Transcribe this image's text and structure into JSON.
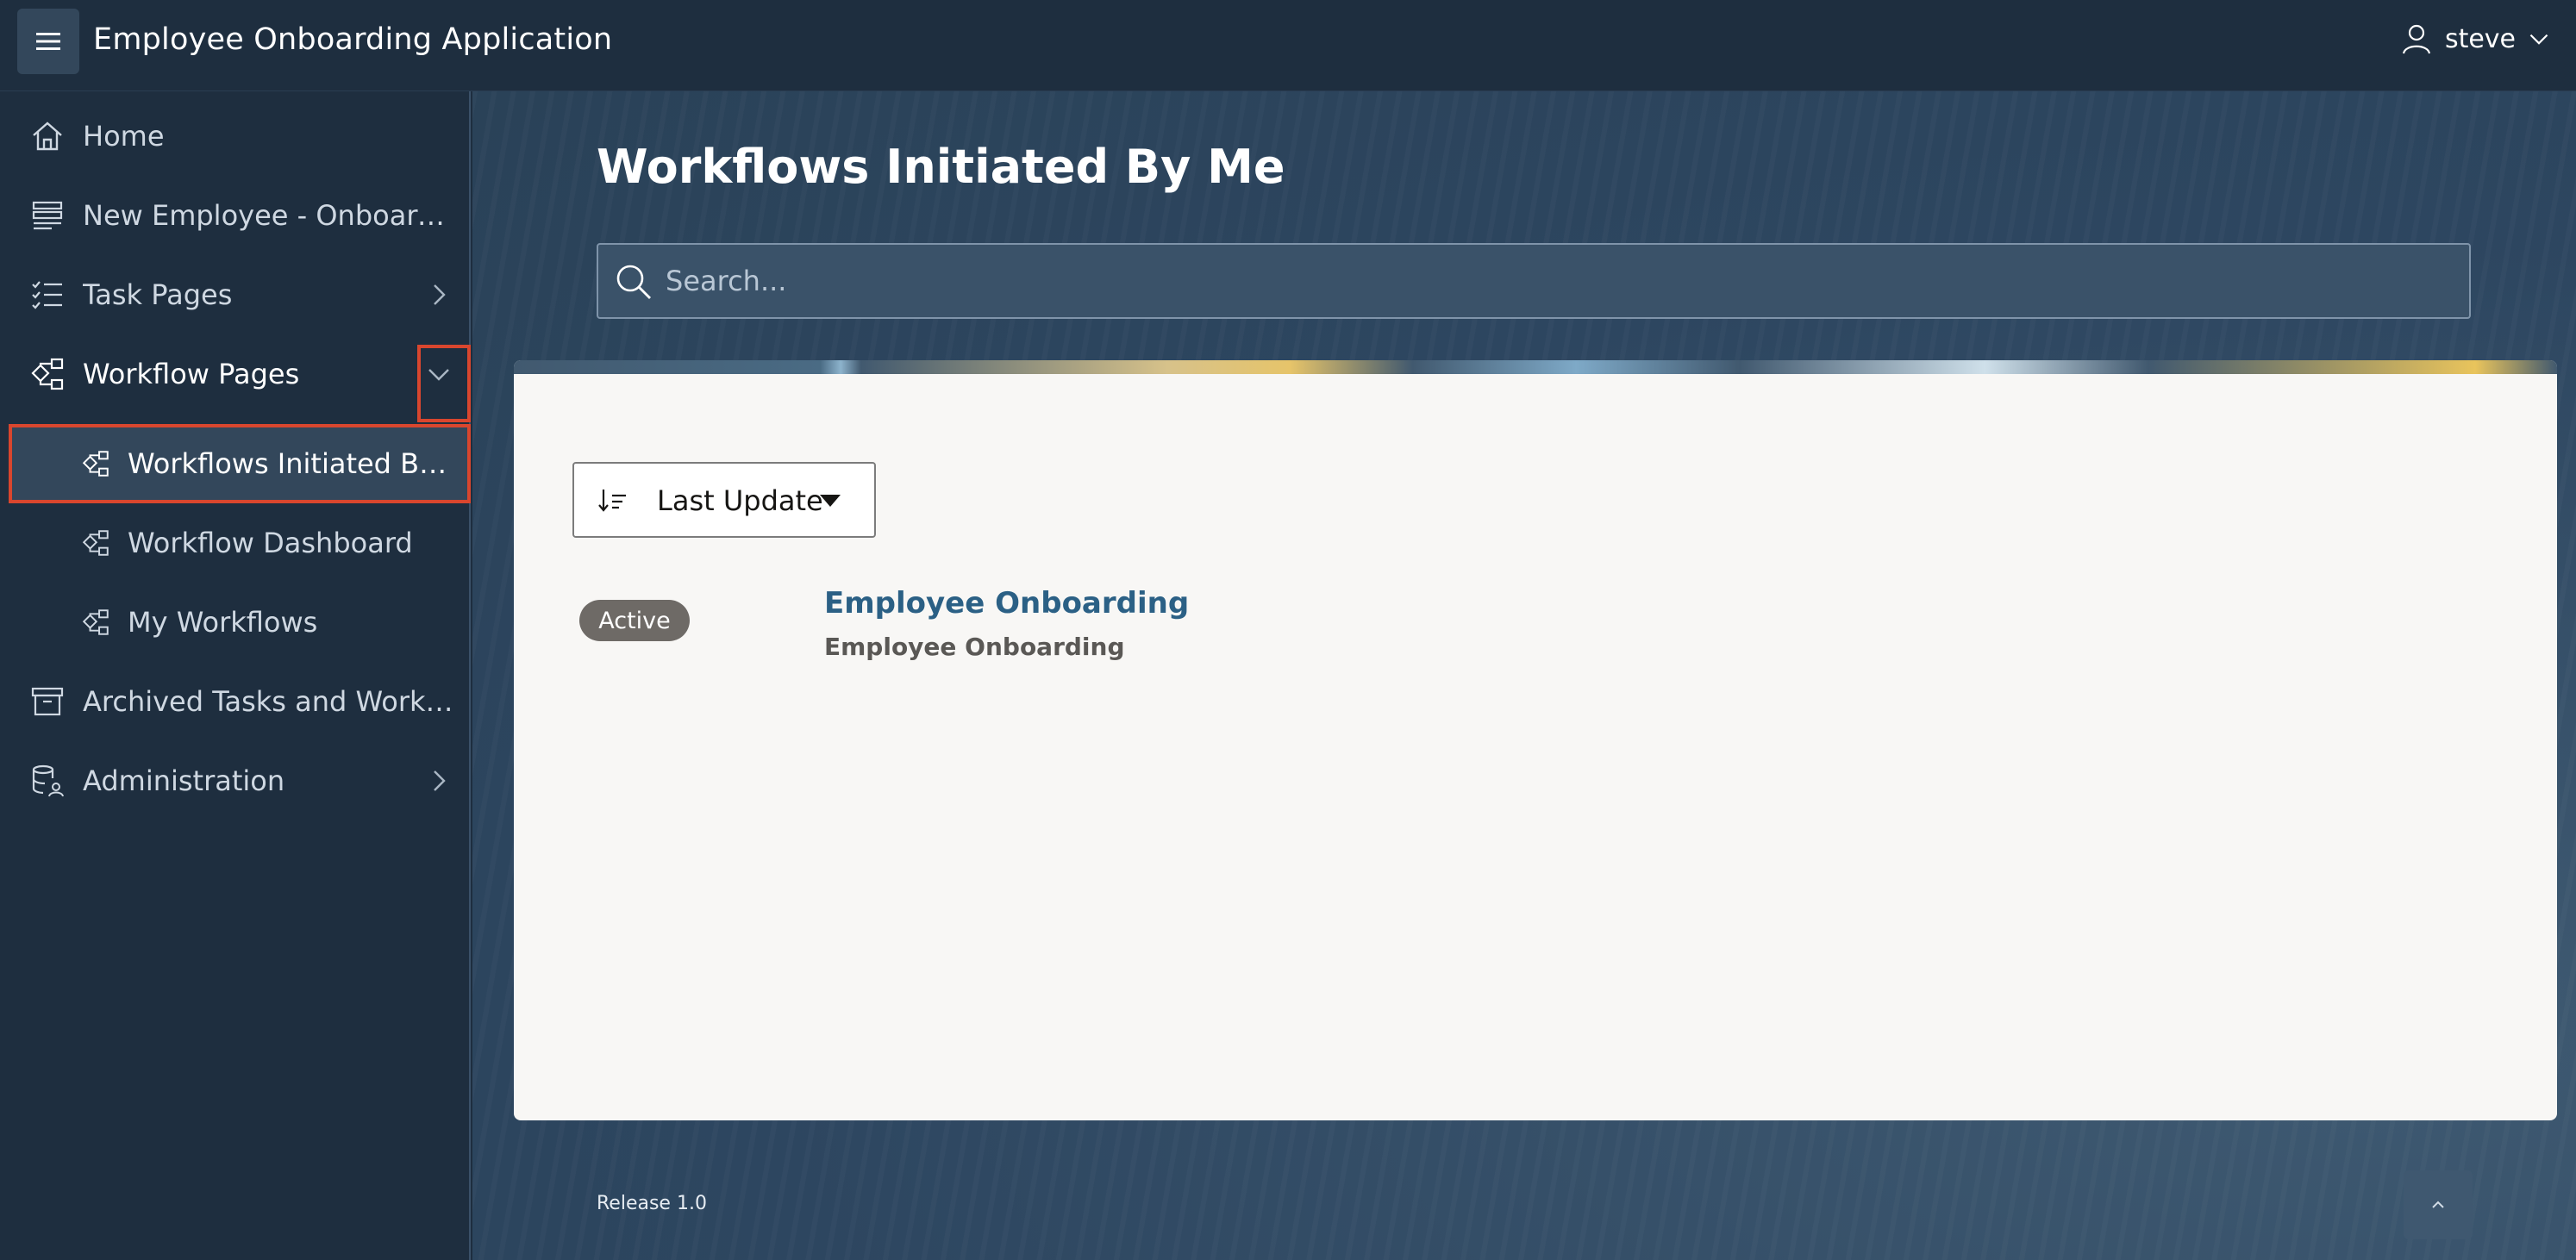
{
  "header": {
    "app_title": "Employee Onboarding Application",
    "user_name": "steve",
    "menu_icon": "hamburger-icon",
    "user_icon": "user-icon"
  },
  "sidebar": {
    "items": [
      {
        "label": "Home",
        "icon": "home-icon"
      },
      {
        "label": "New Employee - Onboarding",
        "icon": "form-icon"
      },
      {
        "label": "Task Pages",
        "icon": "checklist-icon",
        "chevron": "chevron-right-icon"
      },
      {
        "label": "Workflow Pages",
        "icon": "workflow-icon",
        "chevron": "chevron-down-icon",
        "expanded": true
      },
      {
        "label": "Workflows Initiated By ...",
        "icon": "workflow-icon",
        "current": true
      },
      {
        "label": "Workflow Dashboard",
        "icon": "workflow-icon"
      },
      {
        "label": "My Workflows",
        "icon": "workflow-icon"
      },
      {
        "label": "Archived Tasks and Workfl...",
        "icon": "archive-icon"
      },
      {
        "label": "Administration",
        "icon": "database-user-icon",
        "chevron": "chevron-right-icon"
      }
    ]
  },
  "main": {
    "page_title": "Workflows Initiated By Me",
    "search": {
      "placeholder": "Search...",
      "value": ""
    },
    "sort": {
      "label": "Last Update"
    },
    "results": [
      {
        "status": "Active",
        "title": "Employee Onboarding",
        "subtitle": "Employee Onboarding"
      }
    ]
  },
  "footer": {
    "release": "Release 1.0"
  },
  "colors": {
    "header_bg": "#1e2e3f",
    "sidebar_active_bg": "#33475b",
    "highlight": "#d9462e",
    "link": "#2b6085",
    "badge_bg": "#6e6a66"
  }
}
